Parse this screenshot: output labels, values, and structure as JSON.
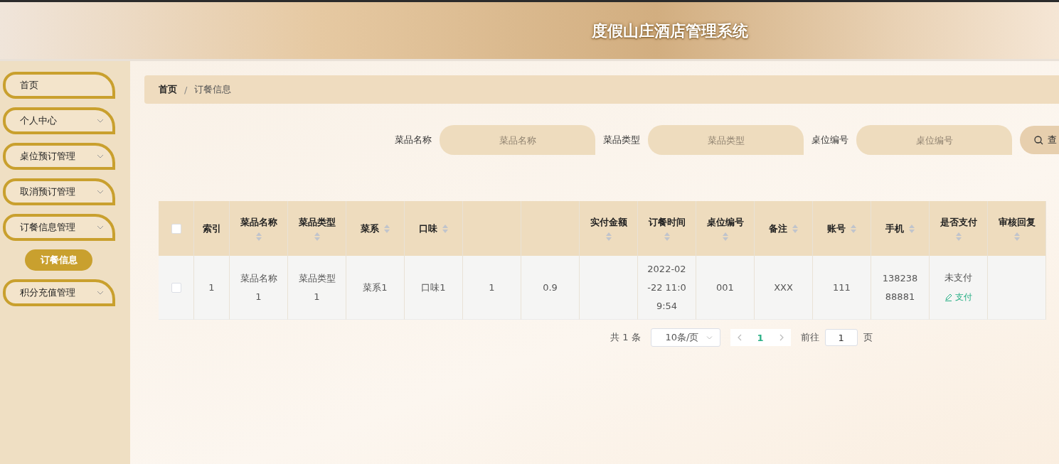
{
  "header": {
    "title": "度假山庄酒店管理系统"
  },
  "sidebar": {
    "items": [
      {
        "label": "首页",
        "expandable": false
      },
      {
        "label": "个人中心",
        "expandable": true
      },
      {
        "label": "桌位预订管理",
        "expandable": true
      },
      {
        "label": "取消预订管理",
        "expandable": true
      },
      {
        "label": "订餐信息管理",
        "expandable": true,
        "children": [
          {
            "label": "订餐信息",
            "selected": true
          }
        ]
      },
      {
        "label": "积分充值管理",
        "expandable": true
      }
    ]
  },
  "breadcrumb": {
    "items": [
      "首页",
      "订餐信息"
    ],
    "separator": "/"
  },
  "search": {
    "fields": [
      {
        "label": "菜品名称",
        "placeholder": "菜品名称"
      },
      {
        "label": "菜品类型",
        "placeholder": "菜品类型"
      },
      {
        "label": "桌位编号",
        "placeholder": "桌位编号"
      }
    ],
    "button": "查"
  },
  "table": {
    "columns": [
      {
        "kind": "check",
        "checked": false
      },
      {
        "kind": "text",
        "title": "索引",
        "sortable": false
      },
      {
        "kind": "text",
        "title": "菜品名称",
        "sortable": true
      },
      {
        "kind": "text",
        "title": "菜品类型",
        "sortable": true
      },
      {
        "kind": "text",
        "title": "菜系",
        "sortable": true
      },
      {
        "kind": "text",
        "title": "口味",
        "sortable": true
      },
      {
        "kind": "text"
      },
      {
        "kind": "text"
      },
      {
        "kind": "text",
        "title": "实付金额",
        "sortable": true
      },
      {
        "kind": "text",
        "title": "订餐时间",
        "sortable": true
      },
      {
        "kind": "text",
        "title": "桌位编号",
        "sortable": true
      },
      {
        "kind": "text",
        "title": "备注",
        "sortable": true
      },
      {
        "kind": "text",
        "title": "账号",
        "sortable": true
      },
      {
        "kind": "text",
        "title": "手机",
        "sortable": true
      },
      {
        "kind": "pay",
        "title": "是否支付",
        "sortable": true
      },
      {
        "kind": "text",
        "title": "审核回复",
        "sortable": true
      }
    ],
    "rows": [
      {
        "checked": false,
        "cells": [
          null,
          "1",
          "菜品名称1",
          "菜品类型1",
          "菜系1",
          "口味1",
          "1",
          "0.9",
          null,
          "2022-02-22 11:09:54",
          "001",
          "XXX",
          "111",
          "13823888881",
          {
            "status": "未支付",
            "action": "支付"
          },
          null
        ]
      }
    ]
  },
  "pagination": {
    "total": "共 1 条",
    "page_size": "10条/页",
    "pages": [
      {
        "label": "1",
        "selected": true
      }
    ],
    "goto_label": "前往",
    "goto_value": "1",
    "goto_unit": "页"
  }
}
